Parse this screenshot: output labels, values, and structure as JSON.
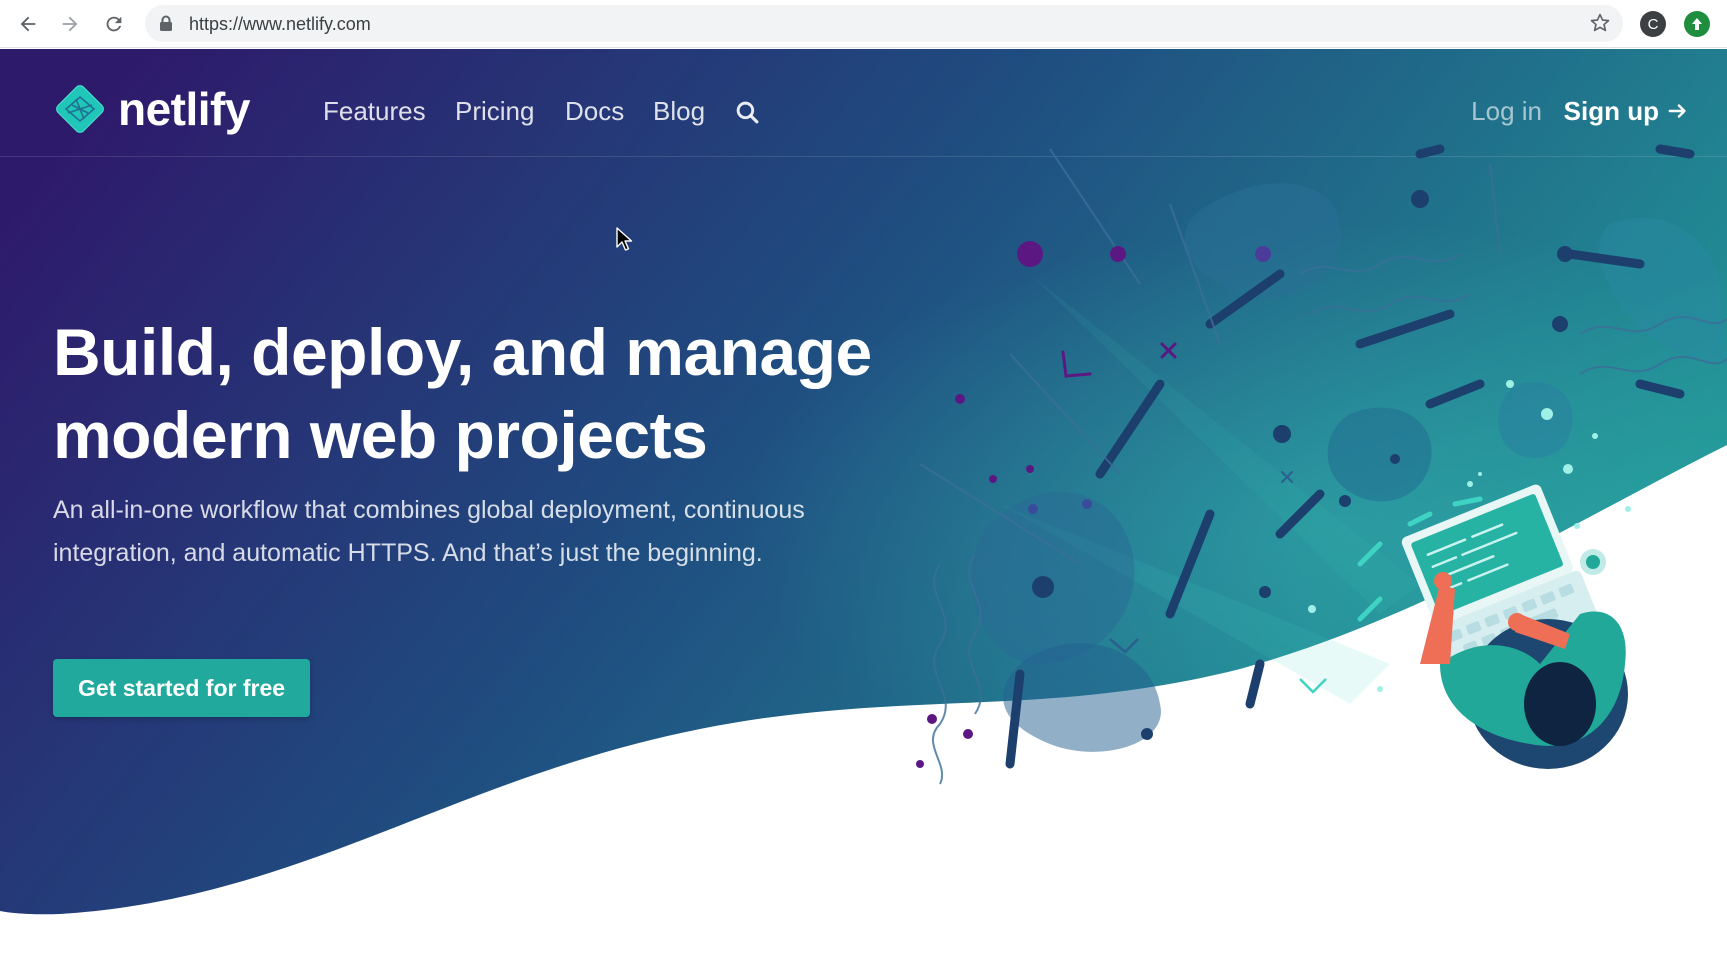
{
  "browser": {
    "url": "https://www.netlify.com",
    "icons": {
      "back": "back-arrow-icon",
      "forward": "forward-arrow-icon",
      "reload": "reload-icon",
      "lock": "lock-icon",
      "bookmark": "star-icon"
    },
    "profile_initial": "C"
  },
  "site": {
    "logo_text": "netlify",
    "nav": [
      "Features",
      "Pricing",
      "Docs",
      "Blog"
    ],
    "login": "Log in",
    "signup": "Sign up"
  },
  "hero": {
    "title_line1": "Build, deploy, and manage",
    "title_line2": "modern web projects",
    "subtitle": "An all-in-one workflow that combines global deployment, continuous integration, and automatic HTTPS. And that’s just the beginning.",
    "cta": "Get started for free"
  },
  "colors": {
    "gradient_start": "#2e1a6b",
    "gradient_mid": "#1f4d80",
    "gradient_end": "#229a98",
    "accent": "#20a99c"
  }
}
